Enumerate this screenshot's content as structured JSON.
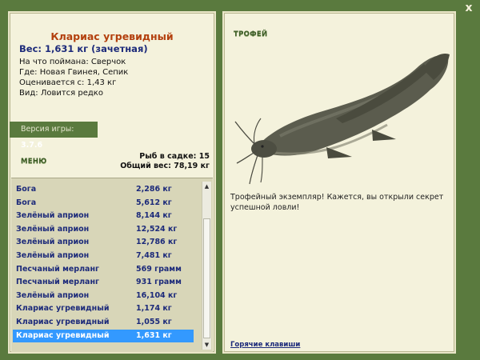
{
  "window": {
    "close_glyph": "x"
  },
  "fish": {
    "title": "Клариас угревидный",
    "weight": "Вес: 1,631 кг (зачетная)",
    "info": [
      "На что поймана: Сверчок",
      "Где: Новая Гвинея, Сепик",
      "Оценивается с: 1,43 кг",
      "Вид: Ловится редко"
    ]
  },
  "version": {
    "label": "Версия игры:",
    "number": "3.7.6"
  },
  "menu": {
    "label": "МЕНЮ"
  },
  "stats": {
    "count": "Рыб в садке: 15",
    "total": "Общий вес: 78,19 кг"
  },
  "catch_list": [
    {
      "name": "Бога",
      "weight": "2,286 кг"
    },
    {
      "name": "Бога",
      "weight": "5,612 кг"
    },
    {
      "name": "Зелёный априон",
      "weight": "8,144 кг"
    },
    {
      "name": "Зелёный априон",
      "weight": "12,524 кг"
    },
    {
      "name": "Зелёный априон",
      "weight": "12,786 кг"
    },
    {
      "name": "Зелёный априон",
      "weight": "7,481 кг"
    },
    {
      "name": "Песчаный мерланг",
      "weight": "569 грамм"
    },
    {
      "name": "Песчаный мерланг",
      "weight": "931 грамм"
    },
    {
      "name": "Зелёный априон",
      "weight": "16,104 кг"
    },
    {
      "name": "Клариас угревидный",
      "weight": "1,174 кг"
    },
    {
      "name": "Клариас угревидный",
      "weight": "1,055 кг"
    },
    {
      "name": "Клариас угревидный",
      "weight": "1,631 кг",
      "selected": true
    }
  ],
  "trophy": {
    "label": "ТРОФЕЙ",
    "text": "Трофейный экземпляр! Кажется, вы открыли секрет успешной ловли!"
  },
  "hotkeys": {
    "label": "Горячие клавиши"
  },
  "colors": {
    "background": "#5a7a3e",
    "panel": "#f4f2dc",
    "title": "#b3400e",
    "text_blue": "#1c2a7a",
    "selected": "#3399ff"
  },
  "icons": {
    "close": "close-icon",
    "scroll_up": "arrow-up-icon",
    "scroll_down": "arrow-down-icon"
  }
}
